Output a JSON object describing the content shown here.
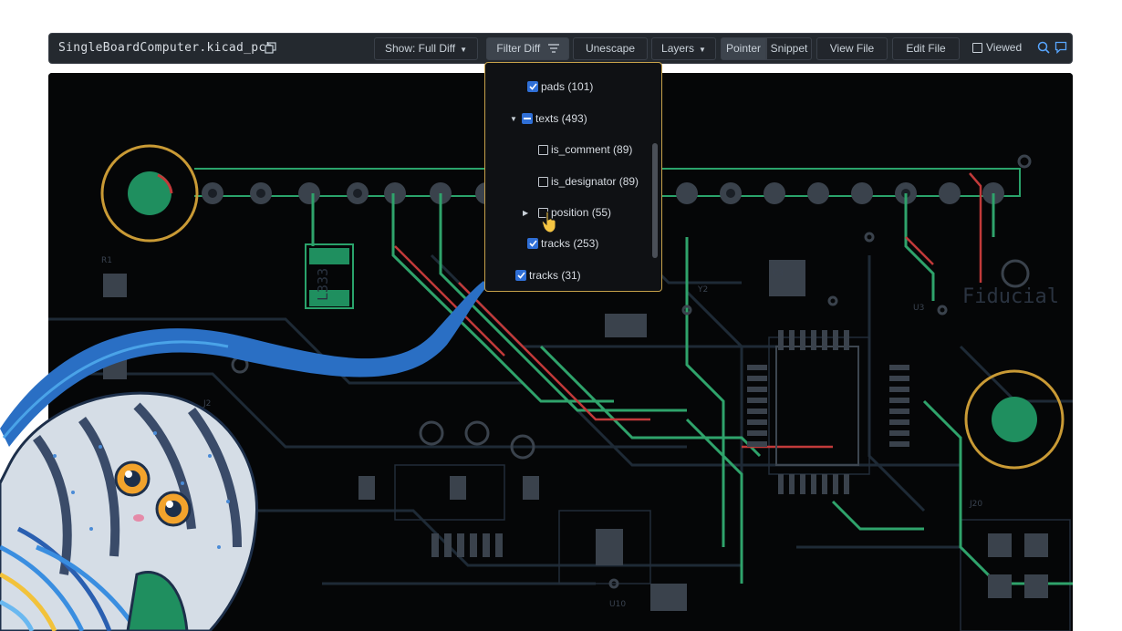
{
  "file": {
    "name": "SingleBoardComputer.kicad_pcb"
  },
  "toolbar": {
    "show_label": "Show: Full Diff",
    "filter_label": "Filter Diff",
    "unescape_label": "Unescape",
    "layers_label": "Layers",
    "pointer_label": "Pointer",
    "snippet_label": "Snippet",
    "view_file_label": "View File",
    "edit_file_label": "Edit File",
    "viewed_label": "Viewed"
  },
  "filter_menu": {
    "items": [
      {
        "label": "pads (101)",
        "state": "checked"
      },
      {
        "label": "texts (493)",
        "state": "mixed",
        "expanded": true
      },
      {
        "label": "is_comment (89)",
        "state": "unchecked"
      },
      {
        "label": "is_designator (89)",
        "state": "unchecked"
      },
      {
        "label": "position (55)",
        "state": "unchecked",
        "expanded": false
      },
      {
        "label": "tracks (253)",
        "state": "checked"
      },
      {
        "label": "tracks (31)",
        "state": "checked"
      }
    ]
  },
  "pcb": {
    "silkscreen": [
      "Fiducial",
      "L333"
    ],
    "designators": [
      "Y2",
      "U3",
      "R1",
      "J2",
      "J20",
      "U10",
      "C3"
    ]
  },
  "colors": {
    "accent": "#2f6fd6",
    "menu_border": "#c6a14a",
    "track_green": "#2fa36b",
    "track_red": "#c23a3a",
    "pad_green": "#1f8f5f",
    "pad_ring": "#c99a35"
  }
}
